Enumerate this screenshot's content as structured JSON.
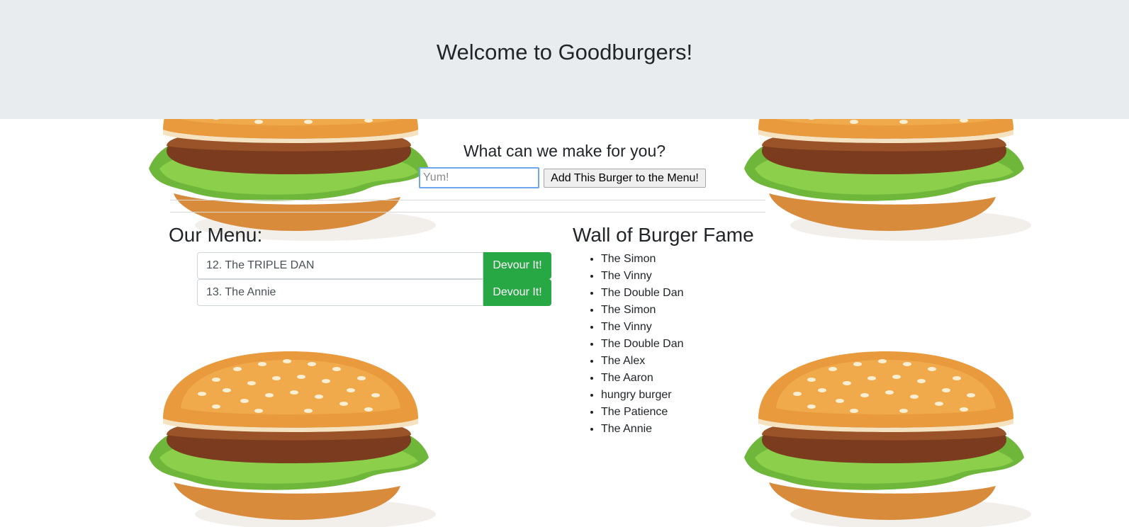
{
  "header": {
    "title": "Welcome to Goodburgers!"
  },
  "form": {
    "title": "What can we make for you?",
    "placeholder": "Yum!",
    "submit_label": "Add This Burger to the Menu!"
  },
  "menu": {
    "title": "Our Menu:",
    "items": [
      {
        "name": "12. The TRIPLE DAN",
        "button": "Devour It!"
      },
      {
        "name": "13. The Annie",
        "button": "Devour It!"
      }
    ]
  },
  "fame": {
    "title": "Wall of Burger Fame",
    "items": [
      "The Simon",
      "The Vinny",
      "The Double Dan",
      "The Simon",
      "The Vinny",
      "The Double Dan",
      "The Alex",
      "The Aaron",
      "hungry burger",
      "The Patience",
      "The Annie"
    ]
  },
  "colors": {
    "jumbotron": "#e9ecef",
    "devour_button": "#28a745",
    "input_focus": "#6ea6f0"
  }
}
